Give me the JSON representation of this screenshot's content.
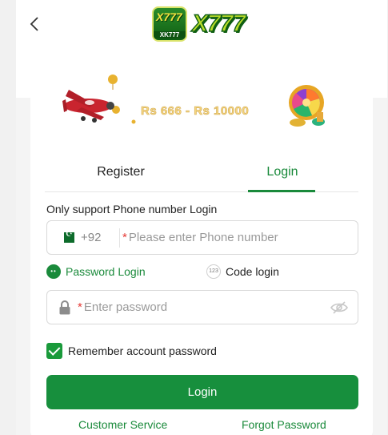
{
  "header": {
    "logo_badge_top": "X777",
    "logo_badge_bottom": "XK777",
    "logo_word": "X777"
  },
  "banner": {
    "text": "Rs 666 - Rs 10000"
  },
  "tabs": [
    {
      "label": "Register",
      "active": false
    },
    {
      "label": "Login",
      "active": true
    }
  ],
  "form": {
    "hint": "Only support Phone number Login",
    "country_code": "+92",
    "phone_placeholder": "Please enter Phone number",
    "required_mark": "*",
    "mode_password": "Password Login",
    "mode_code": "Code login",
    "mode_code_icon": "123",
    "password_placeholder": "Enter password",
    "remember_label": "Remember account password",
    "remember_checked": true,
    "login_button": "Login"
  },
  "footer": {
    "customer_service": "Customer Service",
    "forgot_password": "Forgot Password"
  },
  "colors": {
    "accent": "#1a8a3b",
    "button": "#178f3d",
    "required": "#e53935"
  },
  "icons": {
    "back": "chevron-left-icon",
    "flag": "pakistan-flag-icon",
    "lock": "lock-icon",
    "eye": "eye-hidden-icon"
  }
}
